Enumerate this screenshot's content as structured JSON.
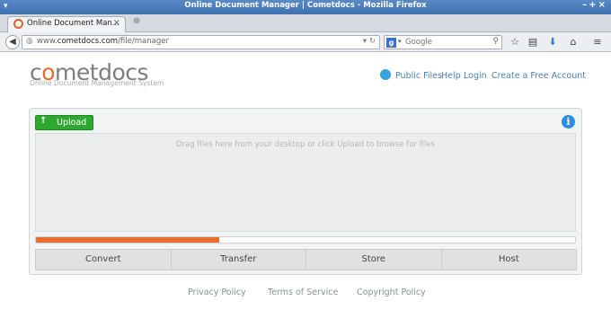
{
  "window": {
    "title": "Online Document Manager | Cometdocs - Mozilla Firefox"
  },
  "tab": {
    "title": "Online Document Man...",
    "close": "×",
    "new_tab": "⊕"
  },
  "nav": {
    "url_prefix": "www.",
    "url_host": "cometdocs.com",
    "url_path": "/file/manager",
    "search_placeholder": "Google",
    "search_engine_letter": "g"
  },
  "brand": {
    "logo_pre": "c",
    "logo_o": "o",
    "logo_post": "metdocs",
    "tagline": "Online Document Management System"
  },
  "topnav": {
    "public_files": "Public Files",
    "help": "Help",
    "login": "Login",
    "create_account": "Create a Free Account"
  },
  "uploader": {
    "upload_label": "Upload",
    "info": "i",
    "drop_hint": "Drag files here from your desktop or click Upload to browse for files",
    "progress_fraction": 0.34,
    "actions": [
      "Convert",
      "Transfer",
      "Store",
      "Host"
    ]
  },
  "footer": {
    "privacy": "Privacy Policy",
    "terms": "Terms of Service",
    "copyright": "Copyright Policy"
  },
  "colors": {
    "accent_orange": "#e96d2c",
    "upload_green": "#2fa82f",
    "link_blue": "#4a7fb0",
    "titlebar_blue": "#4a7cbc"
  }
}
